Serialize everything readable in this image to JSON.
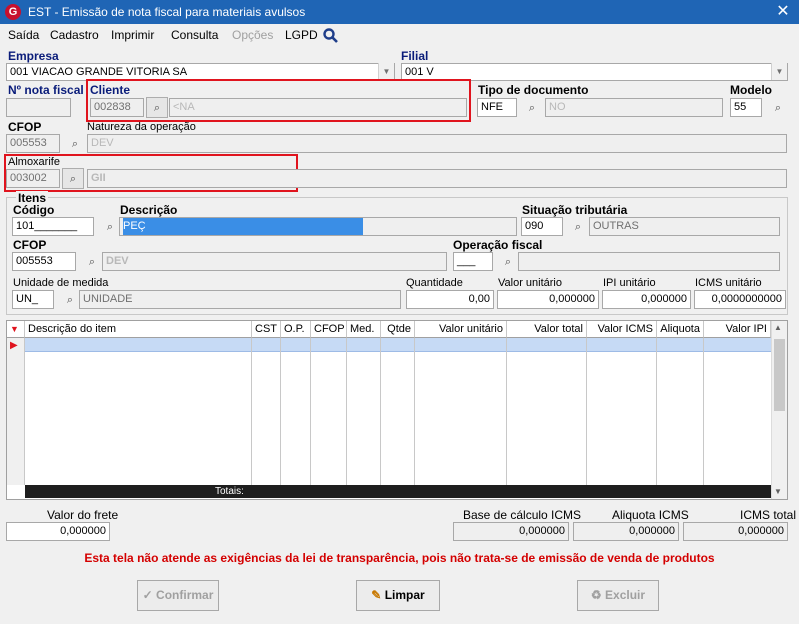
{
  "window": {
    "title": "EST - Emissão de nota fiscal para materiais avulsos",
    "app_icon": "G",
    "close": "✕"
  },
  "menu": [
    "Saída",
    "Cadastro",
    "Imprimir",
    "Consulta",
    "Opções",
    "LGPD"
  ],
  "header": {
    "empresa_label": "Empresa",
    "empresa_value": "001 VIACAO GRANDE VITORIA SA",
    "filial_label": "Filial",
    "filial_value": "001 V",
    "nota_label": "Nº nota fiscal",
    "nota_value": "",
    "cliente_label": "Cliente",
    "cliente_code": "002838",
    "cliente_name": "<NA",
    "tipo_doc_label": "Tipo de documento",
    "tipo_doc_code": "NFE",
    "tipo_doc_name": "NO",
    "modelo_label": "Modelo",
    "modelo_value": "55",
    "cfop_label": "CFOP",
    "cfop_value": "005553",
    "natureza_label": "Natureza da operação",
    "natureza_value": "DEV",
    "almox_label": "Almoxarife",
    "almox_code": "003002",
    "almox_name": "GII"
  },
  "itens": {
    "group_label": "Itens",
    "codigo_label": "Código",
    "codigo_value": "101_______",
    "descricao_label": "Descrição",
    "descricao_value": "PEÇ",
    "sit_trib_label": "Situação tributária",
    "sit_trib_code": "090",
    "sit_trib_name": "OUTRAS",
    "cfop_label": "CFOP",
    "cfop_value": "005553",
    "cfop_desc": "DEV",
    "op_fiscal_label": "Operação fiscal",
    "op_fiscal_value": "___",
    "unidade_label": "Unidade de medida",
    "unidade_code": "UN_",
    "unidade_name": "UNIDADE",
    "quantidade_label": "Quantidade",
    "quantidade_value": "0,00",
    "valor_unit_label": "Valor unitário",
    "valor_unit_value": "0,000000",
    "ipi_label": "IPI unitário",
    "ipi_value": "0,000000",
    "icms_label": "ICMS unitário",
    "icms_value": "0,0000000000"
  },
  "grid": {
    "columns": [
      "Descrição do item",
      "CST",
      "O.P.",
      "CFOP",
      "Med.",
      "Qtde",
      "Valor unitário",
      "Valor total",
      "Valor ICMS",
      "Aliquota",
      "Valor IPI"
    ],
    "totals_label": "Totais:"
  },
  "footer": {
    "frete_label": "Valor do frete",
    "frete_value": "0,000000",
    "base_icms_label": "Base de cálculo ICMS",
    "base_icms_value": "0,000000",
    "aliquota_label": "Aliquota ICMS",
    "aliquota_value": "0,000000",
    "icms_total_label": "ICMS total",
    "icms_total_value": "0,000000"
  },
  "warning": "Esta tela não atende as exigências da lei de transparência, pois não trata-se de emissão de venda de produtos",
  "buttons": {
    "confirmar": "Confirmar",
    "limpar": "Limpar",
    "excluir": "Excluir"
  },
  "colors": {
    "titlebar": "#1f65b5",
    "highlight_red": "#e0141e",
    "warning": "#d40000",
    "label_blue": "#0a1c7a"
  }
}
